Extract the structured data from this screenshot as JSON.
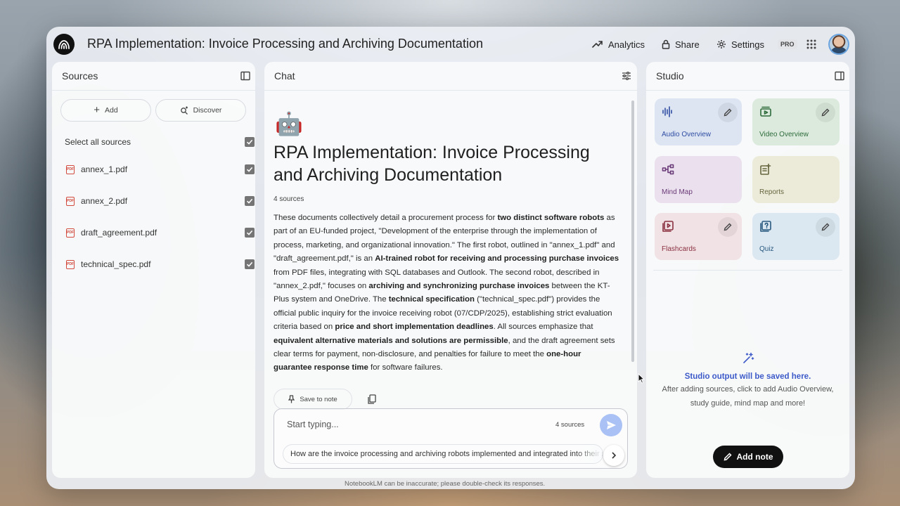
{
  "app": {
    "title": "RPA Implementation: Invoice Processing and Archiving Documentation",
    "header_buttons": {
      "analytics": "Analytics",
      "share": "Share",
      "settings": "Settings",
      "pro_badge": "PRO"
    },
    "icons": {
      "logo": "notebooklm-logo-icon",
      "analytics": "trending-up-icon",
      "share": "lock-icon",
      "settings": "gear-icon",
      "apps": "apps-grid-icon",
      "avatar": "user-avatar"
    },
    "disclaimer": "NotebookLM can be inaccurate; please double-check its responses."
  },
  "sources": {
    "title": "Sources",
    "add_label": "Add",
    "discover_label": "Discover",
    "select_all_label": "Select all sources",
    "select_all_checked": true,
    "items": [
      {
        "label": "annex_1.pdf",
        "checked": true
      },
      {
        "label": "annex_2.pdf",
        "checked": true
      },
      {
        "label": "draft_agreement.pdf",
        "checked": true
      },
      {
        "label": "technical_spec.pdf",
        "checked": true
      }
    ]
  },
  "chat": {
    "title": "Chat",
    "emoji": "🤖",
    "heading": "RPA Implementation: Invoice Processing and Archiving Documentation",
    "source_count": "4 sources",
    "summary_segments": [
      {
        "t": "These documents collectively detail a procurement process for ",
        "b": false
      },
      {
        "t": "two distinct software robots",
        "b": true
      },
      {
        "t": " as part of an EU-funded project, \"Development of the enterprise through the implementation of process, marketing, and organizational innovation.\" The first robot, outlined in \"annex_1.pdf\" and \"draft_agreement.pdf,\" is an ",
        "b": false
      },
      {
        "t": "AI-trained robot for receiving and processing purchase invoices",
        "b": true
      },
      {
        "t": " from PDF files, integrating with SQL databases and Outlook. The second robot, described in \"annex_2.pdf,\" focuses on ",
        "b": false
      },
      {
        "t": "archiving and synchronizing purchase invoices",
        "b": true
      },
      {
        "t": " between the KT-Plus system and OneDrive. The ",
        "b": false
      },
      {
        "t": "technical specification",
        "b": true
      },
      {
        "t": " (\"technical_spec.pdf\") provides the official public inquiry for the invoice receiving robot (07/CDP/2025), establishing strict evaluation criteria based on ",
        "b": false
      },
      {
        "t": "price and short implementation deadlines",
        "b": true
      },
      {
        "t": ". All sources emphasize that ",
        "b": false
      },
      {
        "t": "equivalent alternative materials and solutions are permissible",
        "b": true
      },
      {
        "t": ", and the draft agreement sets clear terms for payment, non-disclosure, and penalties for failure to meet the ",
        "b": false
      },
      {
        "t": "one-hour guarantee response time",
        "b": true
      },
      {
        "t": " for software failures.",
        "b": false
      }
    ],
    "save_to_note": "Save to note",
    "input_placeholder": "Start typing...",
    "input_source_count": "4 sources",
    "suggestion": "How are the invoice processing and archiving robots implemented and integrated into their respective systems?"
  },
  "studio": {
    "title": "Studio",
    "cards": [
      {
        "label": "Audio Overview",
        "icon": "audio-waveform-icon",
        "editable": true,
        "bg": "#dde5f3",
        "fg": "#2f4da3"
      },
      {
        "label": "Video Overview",
        "icon": "video-icon",
        "editable": true,
        "bg": "#dbeadd",
        "fg": "#2e6b3a"
      },
      {
        "label": "Mind Map",
        "icon": "mind-map-icon",
        "editable": false,
        "bg": "#ebe1ee",
        "fg": "#6b3a78"
      },
      {
        "label": "Reports",
        "icon": "reports-icon",
        "editable": false,
        "bg": "#ecebd9",
        "fg": "#666640"
      },
      {
        "label": "Flashcards",
        "icon": "flashcards-icon",
        "editable": true,
        "bg": "#f1e2e5",
        "fg": "#8a3040"
      },
      {
        "label": "Quiz",
        "icon": "quiz-icon",
        "editable": true,
        "bg": "#dbe8f1",
        "fg": "#2a5a80"
      }
    ],
    "empty_title": "Studio output will be saved here.",
    "empty_subtitle": "After adding sources, click to add Audio Overview, study guide, mind map and more!",
    "add_note": "Add note"
  }
}
